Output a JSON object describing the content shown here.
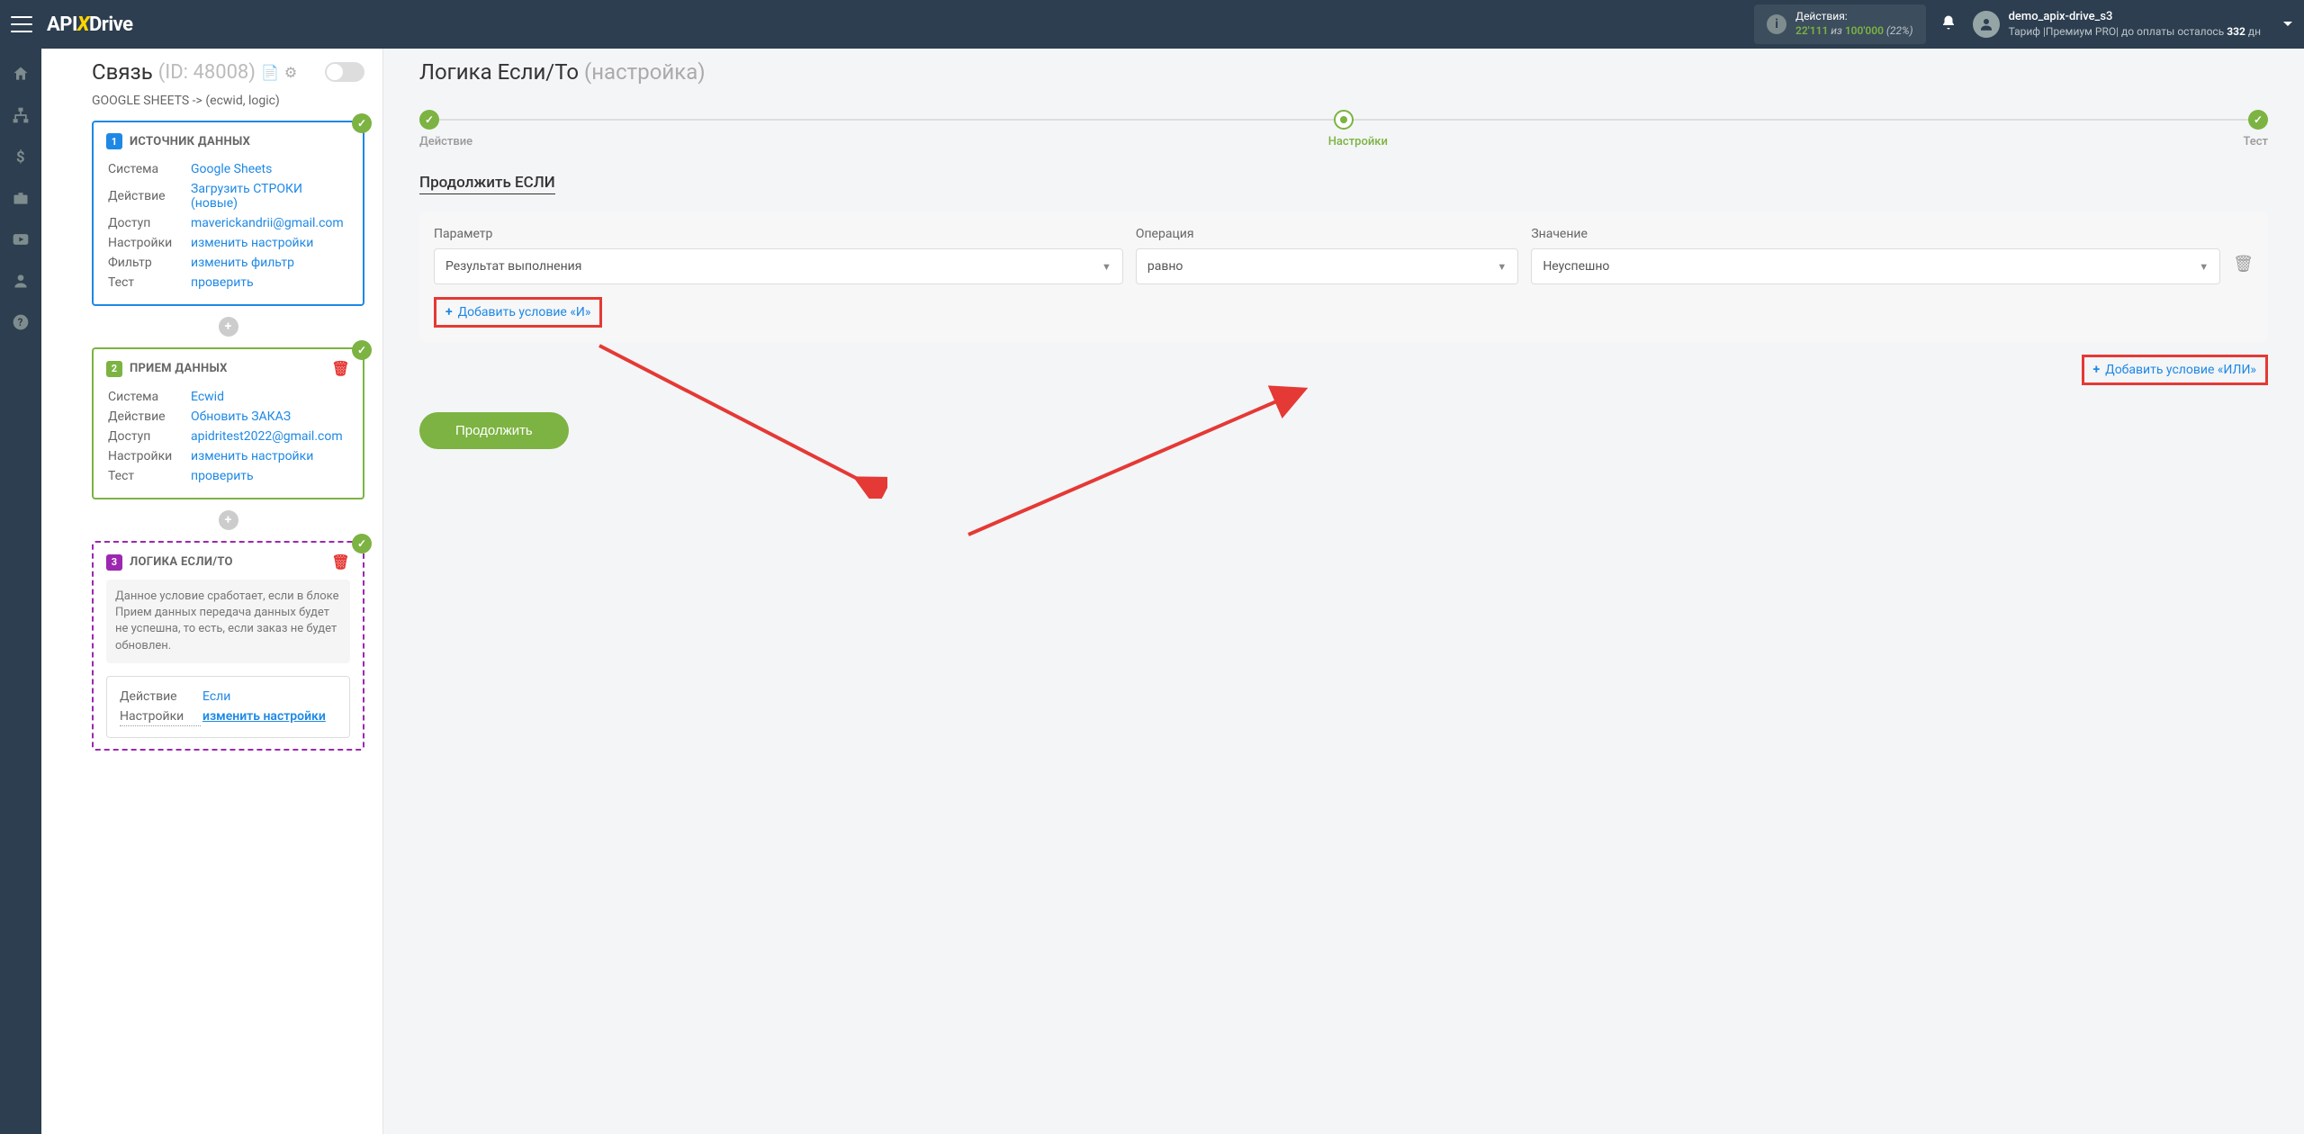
{
  "header": {
    "logo_pre": "API",
    "logo_x": "X",
    "logo_post": "Drive",
    "actions_label": "Действия:",
    "actions_used": "22'111",
    "actions_of": " из ",
    "actions_total": "100'000",
    "actions_pct": "(22%)",
    "user_name": "demo_apix-drive_s3",
    "user_sub_1": "Тариф |Премиум PRO| до оплаты осталось ",
    "user_sub_days": "332",
    "user_sub_2": " дн"
  },
  "sidebar": {
    "conn_title": "Связь",
    "conn_id": "(ID: 48008)",
    "conn_path": "GOOGLE SHEETS -> (ecwid, logic)",
    "src": {
      "title": "ИСТОЧНИК ДАННЫХ",
      "num": "1",
      "rows": {
        "system_l": "Система",
        "system_v": "Google Sheets",
        "action_l": "Действие",
        "action_v": "Загрузить СТРОКИ (новые)",
        "access_l": "Доступ",
        "access_v": "maverickandrii@gmail.com",
        "settings_l": "Настройки",
        "settings_v": "изменить настройки",
        "filter_l": "Фильтр",
        "filter_v": "изменить фильтр",
        "test_l": "Тест",
        "test_v": "проверить"
      }
    },
    "dst": {
      "title": "ПРИЕМ ДАННЫХ",
      "num": "2",
      "rows": {
        "system_l": "Система",
        "system_v": "Ecwid",
        "action_l": "Действие",
        "action_v": "Обновить ЗАКАЗ",
        "access_l": "Доступ",
        "access_v": "apidritest2022@gmail.com",
        "settings_l": "Настройки",
        "settings_v": "изменить настройки",
        "test_l": "Тест",
        "test_v": "проверить"
      }
    },
    "logic": {
      "title": "ЛОГИКА ЕСЛИ/ТО",
      "num": "3",
      "note": "Данное условие сработает, если в блоке Прием данных передача данных будет не успешна, то есть, если заказ не будет обновлен.",
      "rows": {
        "action_l": "Действие",
        "action_v": "Если",
        "settings_l": "Настройки",
        "settings_v": "изменить настройки"
      }
    }
  },
  "content": {
    "title_main": "Логика Если/То",
    "title_sub": "(настройка)",
    "steps": {
      "s1": "Действие",
      "s2": "Настройки",
      "s3": "Тест"
    },
    "section_title": "Продолжить ЕСЛИ",
    "fields": {
      "param_l": "Параметр",
      "param_v": "Результат выполнения",
      "op_l": "Операция",
      "op_v": "равно",
      "val_l": "Значение",
      "val_v": "Неуспешно"
    },
    "add_and": "Добавить условие «И»",
    "add_or": "Добавить условие «ИЛИ»",
    "continue": "Продолжить"
  }
}
